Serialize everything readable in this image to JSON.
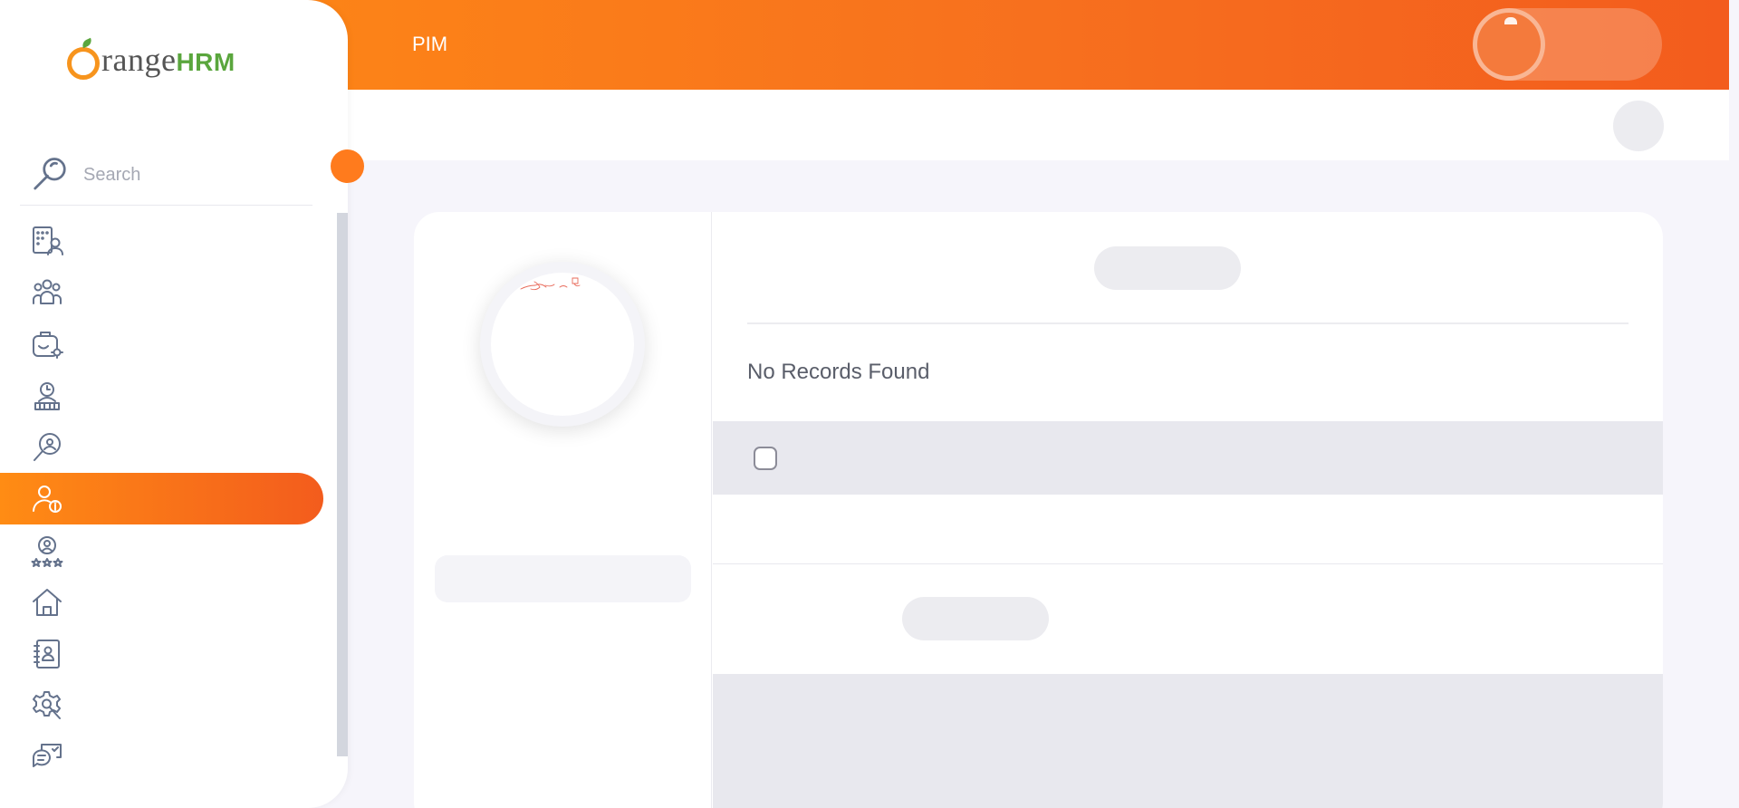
{
  "header": {
    "module_title": "PIM"
  },
  "brand": {
    "logo_text": "OrangeHRM"
  },
  "sidebar": {
    "search_placeholder": "Search",
    "items": [
      {
        "icon": "admin-icon",
        "active": false
      },
      {
        "icon": "pim-icon",
        "active": false
      },
      {
        "icon": "leave-icon",
        "active": false
      },
      {
        "icon": "time-icon",
        "active": false
      },
      {
        "icon": "recruitment-icon",
        "active": false
      },
      {
        "icon": "my-info-icon",
        "active": true
      },
      {
        "icon": "performance-icon",
        "active": false
      },
      {
        "icon": "dashboard-icon",
        "active": false
      },
      {
        "icon": "directory-icon",
        "active": false
      },
      {
        "icon": "maintenance-icon",
        "active": false
      },
      {
        "icon": "buzz-icon",
        "active": false
      }
    ]
  },
  "main": {
    "no_records_text": "No Records Found"
  },
  "colors": {
    "accent": "#ff7b1d",
    "header_start": "#ff8c14",
    "header_end": "#f35c1d",
    "icon_stroke": "#64728c"
  }
}
